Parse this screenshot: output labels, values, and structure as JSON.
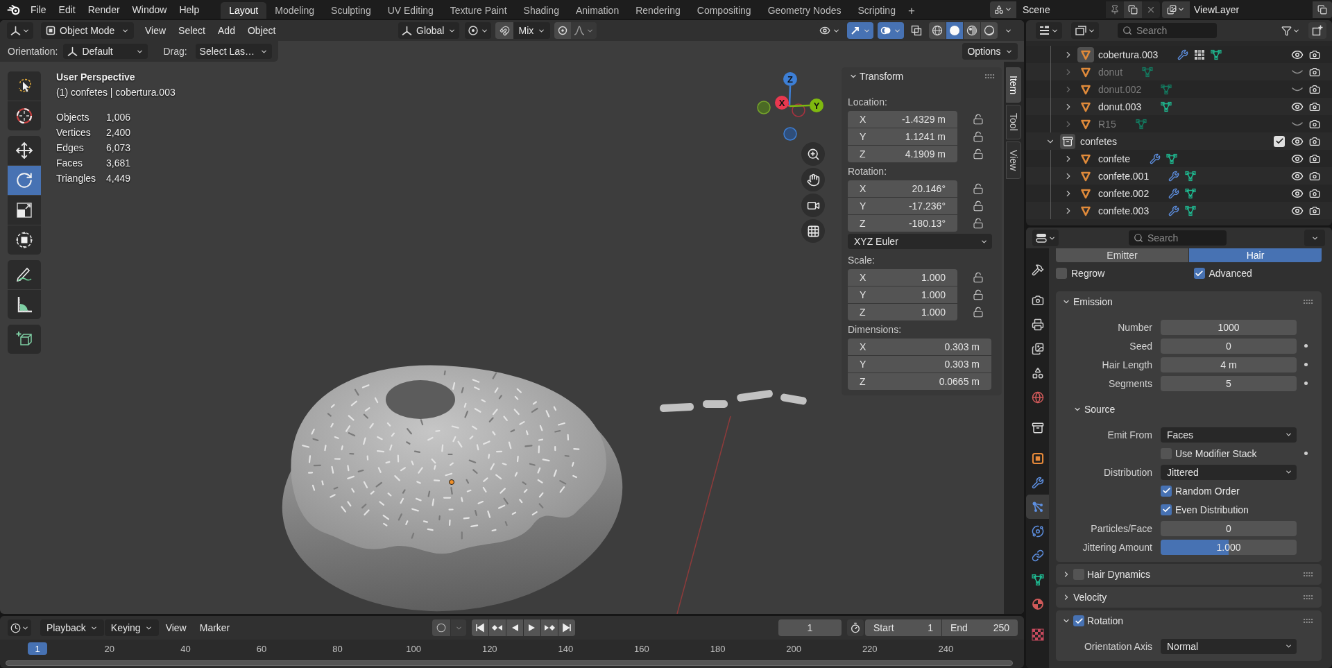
{
  "top_bar": {
    "menus": [
      "File",
      "Edit",
      "Render",
      "Window",
      "Help"
    ],
    "workspaces": [
      {
        "label": "Layout",
        "selected": true
      },
      {
        "label": "Modeling",
        "selected": false
      },
      {
        "label": "Sculpting",
        "selected": false
      },
      {
        "label": "UV Editing",
        "selected": false
      },
      {
        "label": "Texture Paint",
        "selected": false
      },
      {
        "label": "Shading",
        "selected": false
      },
      {
        "label": "Animation",
        "selected": false
      },
      {
        "label": "Rendering",
        "selected": false
      },
      {
        "label": "Compositing",
        "selected": false
      },
      {
        "label": "Geometry Nodes",
        "selected": false
      },
      {
        "label": "Scripting",
        "selected": false
      }
    ],
    "add_workspace": "+",
    "scene": "Scene",
    "view_layer": "ViewLayer"
  },
  "viewport_header": {
    "mode": "Object Mode",
    "menus": [
      "View",
      "Select",
      "Add",
      "Object"
    ],
    "orientation": "Global",
    "snapping": false,
    "snap_target": "Mix",
    "proportional_editing": false,
    "toggles": [
      {
        "kind": "visibility",
        "on": false
      },
      {
        "kind": "gizmos",
        "on": true
      },
      {
        "kind": "overlays",
        "on": true
      },
      {
        "kind": "xray",
        "on": false
      }
    ],
    "shading": [
      {
        "kind": "wireframe",
        "selected": false
      },
      {
        "kind": "solid",
        "selected": true
      },
      {
        "kind": "material",
        "selected": false
      },
      {
        "kind": "rendered",
        "selected": false
      }
    ]
  },
  "tool_settings": {
    "orientation_label": "Orientation:",
    "orientation": "Default",
    "drag_label": "Drag:",
    "drag": "Select Las…",
    "options": "Options"
  },
  "viewport": {
    "perspective": "User Perspective",
    "object_info": "(1) confetes | cobertura.003",
    "stats": [
      {
        "label": "Objects",
        "value": "1,006"
      },
      {
        "label": "Vertices",
        "value": "2,400"
      },
      {
        "label": "Edges",
        "value": "6,073"
      },
      {
        "label": "Faces",
        "value": "3,681"
      },
      {
        "label": "Triangles",
        "value": "4,449"
      }
    ],
    "tool_groups": [
      {
        "tools": [
          {
            "kind": "select",
            "selected": false
          },
          {
            "kind": "cursor",
            "selected": false
          }
        ]
      },
      {
        "tools": [
          {
            "kind": "move",
            "selected": false
          },
          {
            "kind": "rotate",
            "selected": true
          },
          {
            "kind": "scale",
            "selected": false
          },
          {
            "kind": "transform",
            "selected": false
          }
        ]
      },
      {
        "tools": [
          {
            "kind": "annotate",
            "selected": false
          },
          {
            "kind": "measure",
            "selected": false
          }
        ]
      },
      {
        "tools": [
          {
            "kind": "add_cube",
            "selected": false
          }
        ]
      }
    ],
    "gizmo": {
      "x": "X",
      "y": "Y",
      "z": "Z"
    }
  },
  "sidebar": {
    "tabs": [
      {
        "label": "Item",
        "selected": true
      },
      {
        "label": "Tool",
        "selected": false
      },
      {
        "label": "View",
        "selected": false
      }
    ],
    "panel": {
      "title": "Transform",
      "expanded": true
    },
    "groups": [
      {
        "label": "Location:",
        "fields": [
          {
            "axis": "X",
            "value": "-1.4329 m",
            "locked": false
          },
          {
            "axis": "Y",
            "value": "1.1241 m",
            "locked": false
          },
          {
            "axis": "Z",
            "value": "4.1909 m",
            "locked": false
          }
        ]
      },
      {
        "label": "Rotation:",
        "fields": [
          {
            "axis": "X",
            "value": "20.146°",
            "locked": false
          },
          {
            "axis": "Y",
            "value": "-17.236°",
            "locked": false
          },
          {
            "axis": "Z",
            "value": "-180.13°",
            "locked": false
          }
        ],
        "mode": "XYZ Euler"
      },
      {
        "label": "Scale:",
        "fields": [
          {
            "axis": "X",
            "value": "1.000",
            "locked": false
          },
          {
            "axis": "Y",
            "value": "1.000",
            "locked": false
          },
          {
            "axis": "Z",
            "value": "1.000",
            "locked": false
          }
        ]
      },
      {
        "label": "Dimensions:",
        "fields": [
          {
            "axis": "X",
            "value": "0.303 m"
          },
          {
            "axis": "Y",
            "value": "0.303 m"
          },
          {
            "axis": "Z",
            "value": "0.0665 m"
          }
        ]
      }
    ]
  },
  "outliner": {
    "search": {
      "placeholder": "Search"
    },
    "rows": [
      {
        "kind": "continued",
        "children": [
          {
            "kind": "object",
            "name": "cobertura.003",
            "active": true,
            "expanded": false,
            "visible": true,
            "renderable": true,
            "badges": [
              {
                "kind": "modifier"
              },
              {
                "kind": "particles"
              },
              {
                "kind": "mesh"
              }
            ]
          },
          {
            "kind": "object",
            "name": "donut",
            "active": false,
            "expanded": false,
            "visible": false,
            "renderable": true,
            "badges": [
              {
                "kind": "mesh"
              }
            ]
          },
          {
            "kind": "object",
            "name": "donut.002",
            "active": false,
            "expanded": false,
            "visible": false,
            "renderable": true,
            "badges": [
              {
                "kind": "mesh"
              }
            ]
          },
          {
            "kind": "object",
            "name": "donut.003",
            "active": false,
            "expanded": false,
            "visible": true,
            "renderable": true,
            "badges": [
              {
                "kind": "mesh"
              }
            ]
          },
          {
            "kind": "object",
            "name": "R15",
            "active": false,
            "expanded": false,
            "visible": false,
            "renderable": true,
            "badges": [
              {
                "kind": "mesh"
              }
            ]
          }
        ]
      },
      {
        "kind": "collection",
        "name": "confetes",
        "expanded": true,
        "included": true,
        "visible": true,
        "renderable": true,
        "children": [
          {
            "kind": "object",
            "name": "confete",
            "active": false,
            "expanded": false,
            "visible": true,
            "renderable": true,
            "badges": [
              {
                "kind": "modifier"
              },
              {
                "kind": "mesh"
              }
            ]
          },
          {
            "kind": "object",
            "name": "confete.001",
            "active": false,
            "expanded": false,
            "visible": true,
            "renderable": true,
            "badges": [
              {
                "kind": "modifier"
              },
              {
                "kind": "mesh"
              }
            ]
          },
          {
            "kind": "object",
            "name": "confete.002",
            "active": false,
            "expanded": false,
            "visible": true,
            "renderable": true,
            "badges": [
              {
                "kind": "modifier"
              },
              {
                "kind": "mesh"
              }
            ]
          },
          {
            "kind": "object",
            "name": "confete.003",
            "active": false,
            "expanded": false,
            "visible": true,
            "renderable": true,
            "badges": [
              {
                "kind": "modifier"
              },
              {
                "kind": "mesh"
              }
            ]
          }
        ]
      }
    ]
  },
  "properties": {
    "search": {
      "placeholder": "Search"
    },
    "tab_groups": [
      {
        "tabs": [
          {
            "kind": "tool",
            "selected": false
          }
        ]
      },
      {
        "tabs": [
          {
            "kind": "render",
            "selected": false
          },
          {
            "kind": "output",
            "selected": false
          },
          {
            "kind": "view_layer",
            "selected": false
          },
          {
            "kind": "scene",
            "selected": false
          },
          {
            "kind": "world",
            "selected": false
          }
        ]
      },
      {
        "tabs": [
          {
            "kind": "collection",
            "selected": false
          }
        ]
      },
      {
        "tabs": [
          {
            "kind": "object",
            "selected": false
          },
          {
            "kind": "modifier",
            "selected": false
          },
          {
            "kind": "particles",
            "selected": true
          },
          {
            "kind": "physics",
            "selected": false
          },
          {
            "kind": "constraints",
            "selected": false
          },
          {
            "kind": "data",
            "selected": false
          },
          {
            "kind": "material",
            "selected": false
          }
        ]
      },
      {
        "tabs": [
          {
            "kind": "texture",
            "selected": false
          }
        ]
      }
    ],
    "type_buttons": [
      {
        "label": "Emitter",
        "selected": false
      },
      {
        "label": "Hair",
        "selected": true
      }
    ],
    "options": [
      {
        "label": "Regrow",
        "checked": false
      },
      {
        "label": "Advanced",
        "checked": true
      }
    ],
    "panels": [
      {
        "title": "Emission",
        "expanded": true,
        "rows": [
          {
            "kind": "number",
            "label": "Number",
            "value": "1000"
          },
          {
            "kind": "number",
            "label": "Seed",
            "value": "0",
            "decorator": true
          },
          {
            "kind": "number",
            "label": "Hair Length",
            "value": "4 m",
            "decorator": true
          },
          {
            "kind": "number",
            "label": "Segments",
            "value": "5",
            "decorator": true
          },
          {
            "kind": "subpanel",
            "title": "Source",
            "expanded": true
          },
          {
            "kind": "dropdown",
            "label": "Emit From",
            "value": "Faces"
          },
          {
            "kind": "checkbox",
            "label": "Use Modifier Stack",
            "checked": false,
            "decorator": true
          },
          {
            "kind": "dropdown",
            "label": "Distribution",
            "value": "Jittered"
          },
          {
            "kind": "checkbox",
            "label": "Random Order",
            "checked": true
          },
          {
            "kind": "checkbox",
            "label": "Even Distribution",
            "checked": true
          },
          {
            "kind": "number",
            "label": "Particles/Face",
            "value": "0"
          },
          {
            "kind": "slider",
            "label": "Jittering Amount",
            "value": "1.000",
            "level": 0.5
          }
        ]
      },
      {
        "title": "Hair Dynamics",
        "expanded": false,
        "enabled": false
      },
      {
        "title": "Velocity",
        "expanded": false
      },
      {
        "title": "Rotation",
        "expanded": true,
        "enabled": true,
        "rows": [
          {
            "kind": "dropdown",
            "label": "Orientation Axis",
            "value": "Normal"
          }
        ]
      }
    ]
  },
  "timeline": {
    "menus": [
      {
        "kind": "popover",
        "label": "Playback"
      },
      {
        "kind": "popover",
        "label": "Keying"
      },
      {
        "kind": "menu",
        "label": "View"
      },
      {
        "kind": "menu",
        "label": "Marker"
      }
    ],
    "auto_keying": false,
    "current_frame": "1",
    "preview_range": false,
    "start_label": "Start",
    "start": "1",
    "end_label": "End",
    "end": "250",
    "playhead": "1",
    "ruler": [
      "20",
      "40",
      "60",
      "80",
      "100",
      "120",
      "140",
      "160",
      "180",
      "200",
      "220",
      "240"
    ]
  }
}
